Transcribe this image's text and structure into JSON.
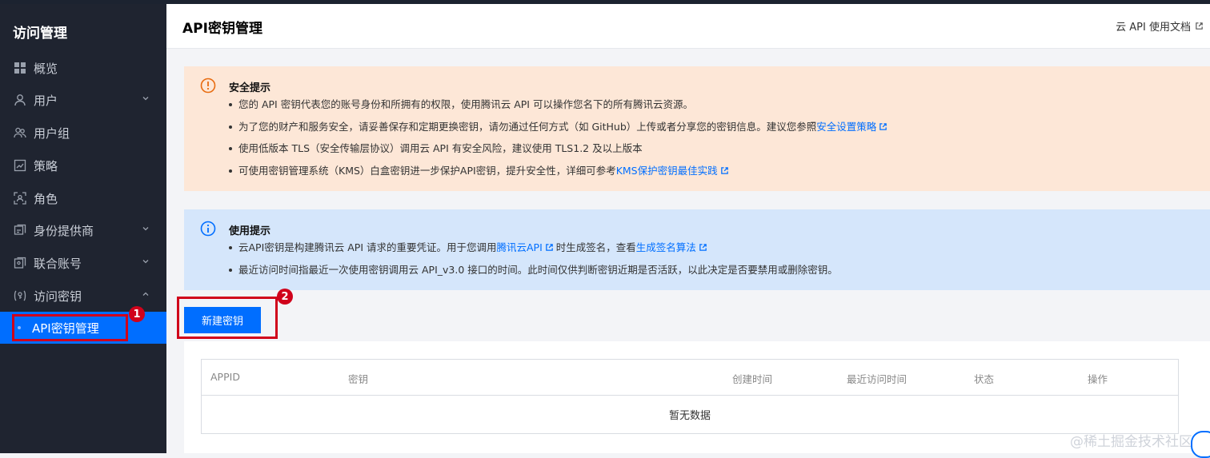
{
  "sidebar": {
    "title": "访问管理",
    "items": [
      {
        "label": "概览",
        "icon": "grid-icon"
      },
      {
        "label": "用户",
        "icon": "user-icon",
        "expandable": true
      },
      {
        "label": "用户组",
        "icon": "user-group-icon"
      },
      {
        "label": "策略",
        "icon": "policy-icon"
      },
      {
        "label": "角色",
        "icon": "role-icon"
      },
      {
        "label": "身份提供商",
        "icon": "identity-provider-icon",
        "expandable": true
      },
      {
        "label": "联合账号",
        "icon": "federated-account-icon",
        "expandable": true
      },
      {
        "label": "访问密钥",
        "icon": "access-key-icon",
        "expanded": true
      }
    ],
    "active_sub": "API密钥管理",
    "accent": "#006eff"
  },
  "annotations": {
    "badge1": "1",
    "badge2": "2",
    "highlight_color": "#d0021b"
  },
  "header": {
    "title": "API密钥管理",
    "doc_link": "云 API 使用文档"
  },
  "security_notice": {
    "title": "安全提示",
    "items": [
      {
        "text": "您的 API 密钥代表您的账号身份和所拥有的权限，使用腾讯云 API 可以操作您名下的所有腾讯云资源。"
      },
      {
        "text": "为了您的财产和服务安全，请妥善保存和定期更换密钥，请勿通过任何方式（如 GitHub）上传或者分享您的密钥信息。建议您参照",
        "link": "安全设置策略"
      },
      {
        "text": "使用低版本 TLS（安全传输层协议）调用云 API 有安全风险，建议使用 TLS1.2 及以上版本"
      },
      {
        "text": "可使用密钥管理系统（KMS）白盒密钥进一步保护API密钥，提升安全性，详细可参考",
        "link": "KMS保护密钥最佳实践"
      }
    ]
  },
  "usage_notice": {
    "title": "使用提示",
    "item1_pre": "云API密钥是构建腾讯云 API 请求的重要凭证。用于您调用",
    "item1_link1": "腾讯云API",
    "item1_mid": "时生成签名，查看",
    "item1_link2": "生成签名算法",
    "item2": "最近访问时间指最近一次使用密钥调用云 API_v3.0 接口的时间。此时间仅供判断密钥近期是否活跃，以此决定是否要禁用或删除密钥。"
  },
  "create_button": "新建密钥",
  "table": {
    "columns": [
      "APPID",
      "密钥",
      "创建时间",
      "最近访问时间",
      "状态",
      "操作"
    ],
    "empty_text": "暂无数据"
  },
  "watermark": "@稀土掘金技术社区"
}
